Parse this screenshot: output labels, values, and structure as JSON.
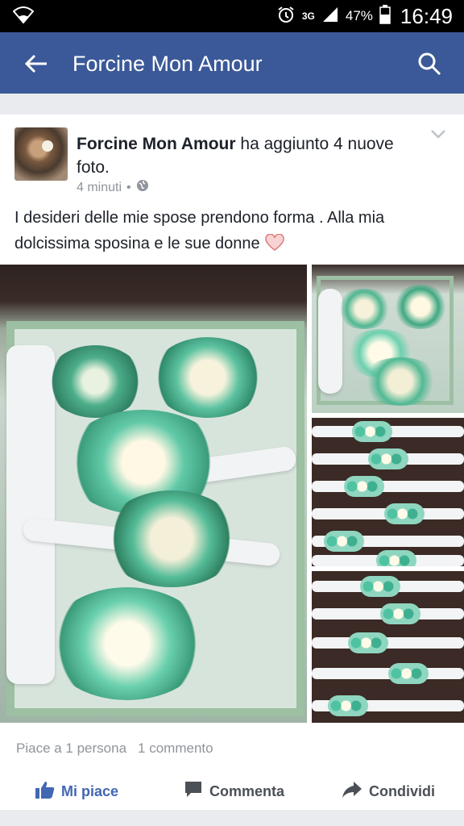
{
  "status_bar": {
    "network": "3G",
    "battery_percent": "47%",
    "time": "16:49"
  },
  "app_bar": {
    "title": "Forcine Mon Amour"
  },
  "post": {
    "author": "Forcine Mon Amour",
    "action_text": " ha aggiunto 4 nuove foto.",
    "timestamp": "4 minuti",
    "separator": "•",
    "text": "I desideri delle mie spose prendono forma . Alla mia dolcissima sposina e le sue donne",
    "likes": "Piace a 1 persona",
    "comments": "1 commento"
  },
  "actions": {
    "like": "Mi piace",
    "comment": "Commenta",
    "share": "Condividi"
  },
  "colors": {
    "brand": "#3b5998",
    "like": "#4267b2"
  }
}
